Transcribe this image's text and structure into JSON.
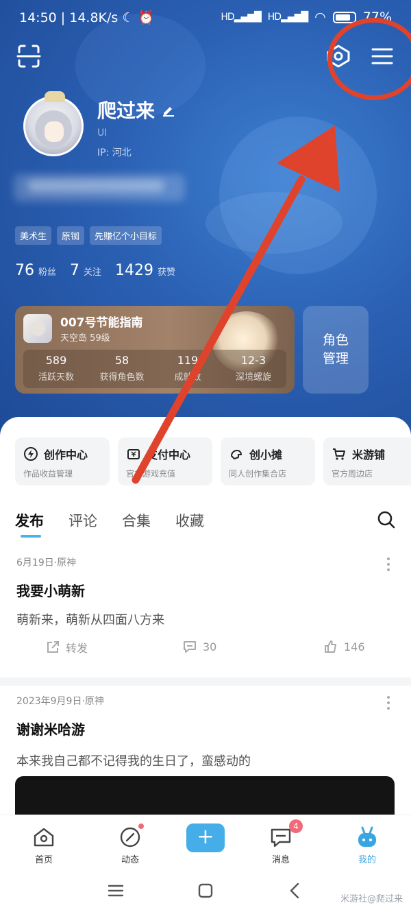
{
  "status_bar": {
    "time": "14:50",
    "speed": "14.8K/s",
    "signal": "HD",
    "battery": "77%"
  },
  "profile": {
    "nickname": "爬过来",
    "uid_label": "UI",
    "ip_label": "IP: 河北",
    "tags": [
      "美术生",
      "原铷",
      "先赚亿个小目标"
    ],
    "stats": [
      {
        "value": "76",
        "label": "粉丝"
      },
      {
        "value": "7",
        "label": "关注"
      },
      {
        "value": "1429",
        "label": "获赞"
      }
    ]
  },
  "game_card": {
    "title": "007号节能指南",
    "subtitle": "天空岛 59级",
    "stats": [
      {
        "value": "589",
        "label": "活跃天数"
      },
      {
        "value": "58",
        "label": "获得角色数"
      },
      {
        "value": "119",
        "label": "成就数"
      },
      {
        "value": "12-3",
        "label": "深境螺旋"
      }
    ]
  },
  "role_button": "角色\n管理",
  "services": [
    {
      "title": "创作中心",
      "subtitle": "作品收益管理",
      "icon": "lightning-icon"
    },
    {
      "title": "支付中心",
      "subtitle": "官方游戏充值",
      "icon": "wallet-icon"
    },
    {
      "title": "创小摊",
      "subtitle": "同人创作集合店",
      "icon": "hand-icon"
    },
    {
      "title": "米游铺",
      "subtitle": "官方周边店",
      "icon": "cart-icon"
    }
  ],
  "tabs": [
    "发布",
    "评论",
    "合集",
    "收藏"
  ],
  "posts": [
    {
      "meta": "6月19日·原神",
      "title": "我要小萌新",
      "body": "萌新来，萌新从四面八方来",
      "share_label": "转发",
      "comments": "30",
      "likes": "146"
    },
    {
      "meta": "2023年9月9日·原神",
      "title": "谢谢米哈游",
      "body": "本来我自己都不记得我的生日了，蛮感动的"
    }
  ],
  "bottom_nav": {
    "home": "首页",
    "feed": "动态",
    "plus": "+",
    "messages": "消息",
    "messages_badge": "4",
    "me": "我的"
  },
  "watermark": "米游社@爬过来",
  "colors": {
    "header_blue": "#2a5fb2",
    "accent": "#45aee8",
    "annotation_red": "#e0432c"
  }
}
